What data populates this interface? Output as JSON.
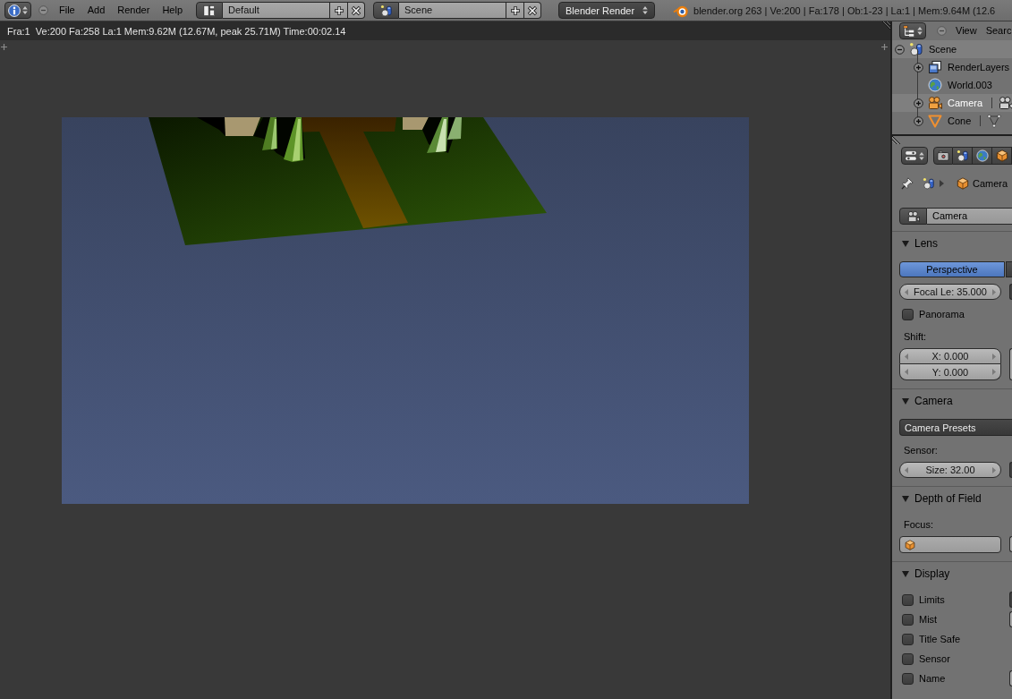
{
  "top_bar": {
    "menus": [
      "File",
      "Add",
      "Render",
      "Help"
    ],
    "screen_layout": "Default",
    "scene": "Scene",
    "render_engine": "Blender Render",
    "stats": "blender.org 263 | Ve:200 | Fa:178 | Ob:1-23 | La:1 | Mem:9.64M (12.6"
  },
  "image_editor": {
    "render_info": "Fra:1  Ve:200 Fa:258 La:1 Mem:9.62M (12.67M, peak 25.71M) Time:00:02.14"
  },
  "outliner": {
    "menus": [
      "View",
      "Searc"
    ],
    "tree": [
      {
        "label": "Scene",
        "kind": "scene",
        "expanded": true,
        "selected": true,
        "active": false,
        "children": [
          {
            "label": "RenderLayers",
            "kind": "render_layers",
            "expanded": false,
            "selected": false,
            "active": false
          },
          {
            "label": "World.003",
            "kind": "world",
            "selected": false,
            "active": false
          },
          {
            "label": "Camera",
            "kind": "camera",
            "expanded": false,
            "selected": true,
            "active": true
          },
          {
            "label": "Cone",
            "kind": "mesh",
            "expanded": false,
            "selected": false,
            "active": false
          }
        ]
      }
    ]
  },
  "properties": {
    "tabs": [
      {
        "kind": "render",
        "selected": false
      },
      {
        "kind": "scene",
        "selected": false
      },
      {
        "kind": "world",
        "selected": false
      },
      {
        "kind": "object",
        "selected": false
      }
    ],
    "breadcrumb": [
      {
        "kind": "scene"
      },
      {
        "kind": "object",
        "label": "Camera"
      }
    ],
    "datablock": {
      "kind": "camera",
      "value": "Camera"
    },
    "panels": [
      {
        "title": "Lens",
        "expanded": true,
        "rows": [
          {
            "kind": "tabs",
            "tabs": [
              {
                "label": "Perspective",
                "selected": true
              },
              {
                "selected": false
              }
            ]
          },
          {
            "kind": "number",
            "value": "Focal Le: 35.000",
            "stub": {
              "kind": "menu"
            }
          },
          {
            "kind": "checkbox",
            "label": "Panorama",
            "checked": false
          },
          {
            "kind": "label",
            "text": "Shift:"
          },
          {
            "kind": "number_column",
            "values": [
              "X: 0.000",
              "Y: 0.000"
            ],
            "stub": {
              "kind": "field"
            }
          }
        ]
      },
      {
        "title": "Camera",
        "expanded": true,
        "rows": [
          {
            "kind": "menu",
            "value": "Camera Presets"
          },
          {
            "kind": "label",
            "text": "Sensor:"
          },
          {
            "kind": "number",
            "value": "Size: 32.00",
            "stub": {
              "kind": "menu"
            }
          }
        ]
      },
      {
        "title": "Depth of Field",
        "expanded": true,
        "rows": [
          {
            "kind": "label",
            "text": "Focus:"
          },
          {
            "kind": "object_field",
            "stub": {
              "kind": "field"
            }
          }
        ]
      },
      {
        "title": "Display",
        "expanded": true,
        "rows": [
          {
            "kind": "checkbox",
            "label": "Limits",
            "checked": false,
            "stub": {
              "kind": "menu"
            }
          },
          {
            "kind": "checkbox",
            "label": "Mist",
            "checked": false,
            "stub": {
              "kind": "field"
            }
          },
          {
            "kind": "checkbox",
            "label": "Title Safe",
            "checked": false
          },
          {
            "kind": "checkbox",
            "label": "Sensor",
            "checked": false
          },
          {
            "kind": "checkbox",
            "label": "Name",
            "checked": false,
            "stub": {
              "kind": "field"
            }
          }
        ]
      }
    ]
  }
}
